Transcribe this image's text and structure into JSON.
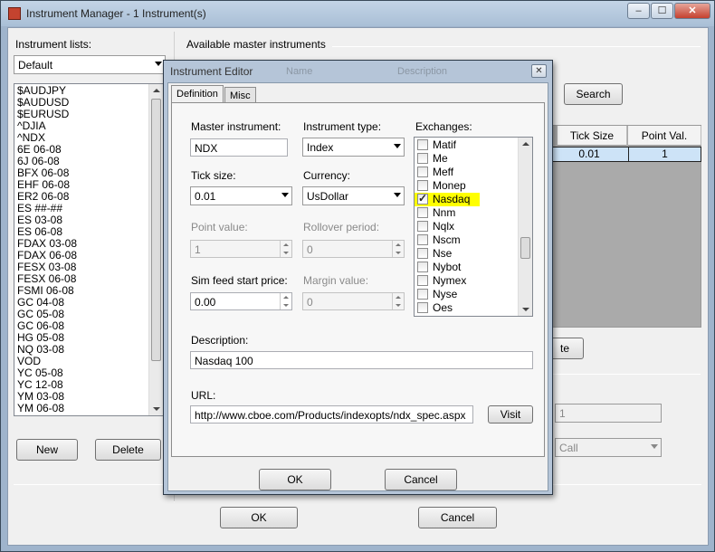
{
  "window": {
    "title": "Instrument Manager - 1 Instrument(s)",
    "minimize": "–",
    "maximize": "☐",
    "close": "✕"
  },
  "left": {
    "lists_label": "Instrument lists:",
    "lists_selected": "Default",
    "instruments": [
      "$AUDJPY",
      "$AUDUSD",
      "$EURUSD",
      "^DJIA",
      "^NDX",
      "6E 06-08",
      "6J 06-08",
      "BFX 06-08",
      "EHF 06-08",
      "ER2 06-08",
      "ES ##-##",
      "ES 03-08",
      "ES 06-08",
      "FDAX 03-08",
      "FDAX 06-08",
      "FESX 03-08",
      "FESX 06-08",
      "FSMI 06-08",
      "GC 04-08",
      "GC 05-08",
      "GC 06-08",
      "HG 05-08",
      "NQ 03-08",
      "VOD",
      "YC 05-08",
      "YC 12-08",
      "YM 03-08",
      "YM 06-08"
    ],
    "new_label": "New",
    "delete_label": "Delete"
  },
  "right": {
    "available_label": "Available master instruments",
    "search_label": "Search",
    "tick_size_header": "Tick Size",
    "point_val_header": "Point Val.",
    "tick_size_value": "0.01",
    "point_val_value": "1",
    "partial_button_label": "te",
    "disabled_value": "1",
    "disabled_combo": "Call"
  },
  "bottom": {
    "ok_label": "OK",
    "cancel_label": "Cancel"
  },
  "dialog": {
    "title": "Instrument Editor",
    "ghost_name": "Name",
    "ghost_description": "Description",
    "close": "✕",
    "tabs": [
      "Definition",
      "Misc"
    ],
    "master_instrument_label": "Master instrument:",
    "master_instrument_value": "NDX",
    "instrument_type_label": "Instrument type:",
    "instrument_type_value": "Index",
    "exchanges_label": "Exchanges:",
    "exchanges": [
      {
        "name": "Matif",
        "checked": false
      },
      {
        "name": "Me",
        "checked": false
      },
      {
        "name": "Meff",
        "checked": false
      },
      {
        "name": "Monep",
        "checked": false
      },
      {
        "name": "Nasdaq",
        "checked": true
      },
      {
        "name": "Nnm",
        "checked": false
      },
      {
        "name": "Nqlx",
        "checked": false
      },
      {
        "name": "Nscm",
        "checked": false
      },
      {
        "name": "Nse",
        "checked": false
      },
      {
        "name": "Nybot",
        "checked": false
      },
      {
        "name": "Nymex",
        "checked": false
      },
      {
        "name": "Nyse",
        "checked": false
      },
      {
        "name": "Oes",
        "checked": false
      }
    ],
    "tick_size_label": "Tick size:",
    "tick_size_value": "0.01",
    "currency_label": "Currency:",
    "currency_value": "UsDollar",
    "point_value_label": "Point value:",
    "point_value_value": "1",
    "rollover_label": "Rollover period:",
    "rollover_value": "0",
    "sim_feed_label": "Sim feed start price:",
    "sim_feed_value": "0.00",
    "margin_label": "Margin value:",
    "margin_value": "0",
    "description_label": "Description:",
    "description_value": "Nasdaq 100",
    "url_label": "URL:",
    "url_value": "http://www.cboe.com/Products/indexopts/ndx_spec.aspx",
    "visit_label": "Visit",
    "ok_label": "OK",
    "cancel_label": "Cancel"
  },
  "colors": {
    "highlight": "#ffff00",
    "selected_row": "#cde3f7"
  }
}
